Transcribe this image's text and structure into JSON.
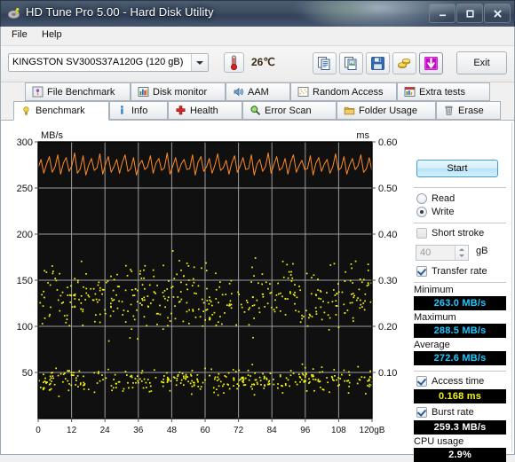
{
  "window": {
    "title": "HD Tune Pro 5.00 - Hard Disk Utility",
    "icon": "hdtune-app-icon",
    "minimize": "–",
    "maximize": "□",
    "close": "✕"
  },
  "menu": {
    "items": [
      {
        "label": "File",
        "accel": "F"
      },
      {
        "label": "Help",
        "accel": "H"
      }
    ]
  },
  "toolbar": {
    "drive_selected": "KINGSTON SV300S37A120G  (120 gB)",
    "temperature": "26℃",
    "temp_icon": "thermometer-icon",
    "buttons": [
      {
        "name": "copy-text-button",
        "icon": "copy-text-icon"
      },
      {
        "name": "copy-image-button",
        "icon": "copy-image-icon"
      },
      {
        "name": "save-button",
        "icon": "floppy-disk-icon"
      },
      {
        "name": "options-button",
        "icon": "gold-coins-icon"
      },
      {
        "name": "download-button",
        "icon": "magenta-down-arrow-icon"
      }
    ],
    "exit_label": "Exit"
  },
  "tabs": {
    "row1": [
      {
        "label": "File Benchmark",
        "icon": "file-benchmark-icon",
        "active": false
      },
      {
        "label": "Disk monitor",
        "icon": "bar-chart-icon",
        "active": false
      },
      {
        "label": "AAM",
        "icon": "speaker-icon",
        "active": false
      },
      {
        "label": "Random Access",
        "icon": "scatter-icon",
        "active": false
      },
      {
        "label": "Extra tests",
        "icon": "extra-tests-icon",
        "active": false
      }
    ],
    "row2": [
      {
        "label": "Benchmark",
        "icon": "benchmark-bulb-icon",
        "active": true
      },
      {
        "label": "Info",
        "icon": "info-icon",
        "active": false
      },
      {
        "label": "Health",
        "icon": "red-cross-icon",
        "active": false
      },
      {
        "label": "Error Scan",
        "icon": "magnifier-icon",
        "active": false
      },
      {
        "label": "Folder Usage",
        "icon": "folder-icon",
        "active": false
      },
      {
        "label": "Erase",
        "icon": "trash-icon",
        "active": false
      }
    ]
  },
  "sidebar": {
    "start_label": "Start",
    "mode_read": "Read",
    "mode_write": "Write",
    "mode_selected": "Write",
    "short_stroke_label": "Short stroke",
    "short_stroke_checked": false,
    "short_stroke_value": "40",
    "short_stroke_unit": "gB",
    "transfer_rate_label": "Transfer rate",
    "transfer_rate_checked": true,
    "minimum_label": "Minimum",
    "minimum_value": "263.0 MB/s",
    "maximum_label": "Maximum",
    "maximum_value": "288.5 MB/s",
    "average_label": "Average",
    "average_value": "272.6 MB/s",
    "access_time_label": "Access time",
    "access_time_checked": true,
    "access_time_value": "0.168 ms",
    "burst_rate_label": "Burst rate",
    "burst_rate_checked": true,
    "burst_rate_value": "259.3 MB/s",
    "cpu_usage_label": "CPU usage",
    "cpu_usage_value": "2.9%"
  },
  "chart_data": {
    "type": "line",
    "title": "",
    "ylabel": "MB/s",
    "y2label": "ms",
    "xlabel": "",
    "xunit": "gB",
    "x": [
      0,
      12,
      24,
      36,
      48,
      60,
      72,
      84,
      96,
      108,
      120
    ],
    "xtick_labels": [
      "0",
      "12",
      "24",
      "36",
      "48",
      "60",
      "72",
      "84",
      "96",
      "108",
      "120gB"
    ],
    "xlim": [
      0,
      120
    ],
    "ylim": [
      0,
      300
    ],
    "ytick_labels": [
      "50",
      "100",
      "150",
      "200",
      "250",
      "300"
    ],
    "yticks": [
      50,
      100,
      150,
      200,
      250,
      300
    ],
    "y2lim": [
      0,
      0.6
    ],
    "y2tick_labels": [
      "0.10",
      "0.20",
      "0.30",
      "0.40",
      "0.50",
      "0.60"
    ],
    "y2ticks": [
      0.1,
      0.2,
      0.3,
      0.4,
      0.5,
      0.6
    ],
    "grid": true,
    "plot_bg": "#0d0d0d",
    "series": [
      {
        "name": "Transfer rate",
        "type": "line",
        "color": "#ff8c21",
        "axis": "left",
        "unit": "MB/s",
        "min": 263.0,
        "max": 288.5,
        "average": 272.6,
        "values": [
          272,
          281,
          266,
          276,
          284,
          267,
          273,
          286,
          265,
          277,
          283,
          268,
          274,
          288,
          266,
          271,
          285,
          264,
          275,
          282,
          269,
          272,
          287,
          265,
          276,
          284,
          267,
          273,
          281,
          266,
          278,
          286,
          268,
          271,
          283,
          264,
          275,
          280,
          270,
          273,
          285,
          266,
          277,
          282,
          269,
          272,
          288,
          265,
          274,
          283,
          267,
          276,
          281,
          270,
          271,
          286,
          264,
          278,
          284,
          268,
          273,
          282,
          266,
          275,
          287,
          269,
          272,
          280,
          265,
          277,
          285,
          267,
          274,
          283,
          270,
          271,
          286,
          264,
          276,
          281,
          268,
          273,
          288,
          266,
          275,
          284,
          269,
          272,
          282,
          265,
          278,
          286,
          267,
          274,
          280,
          270,
          271,
          285,
          264,
          277,
          283,
          268,
          276,
          281,
          266,
          273,
          287,
          269,
          272,
          284,
          265,
          275,
          282,
          270,
          274,
          286,
          267,
          271,
          283,
          268
        ]
      },
      {
        "name": "Access time",
        "type": "scatter",
        "color": "#f5f50a",
        "axis": "right",
        "unit": "ms",
        "average": 0.168,
        "bands": [
          {
            "center_ms": 0.085,
            "spread_ms": 0.012,
            "density": 0.45
          },
          {
            "center_ms": 0.235,
            "spread_ms": 0.02,
            "density": 0.13
          },
          {
            "center_ms": 0.268,
            "spread_ms": 0.03,
            "density": 0.34
          },
          {
            "center_ms": 0.305,
            "spread_ms": 0.022,
            "density": 0.08
          }
        ]
      }
    ]
  }
}
